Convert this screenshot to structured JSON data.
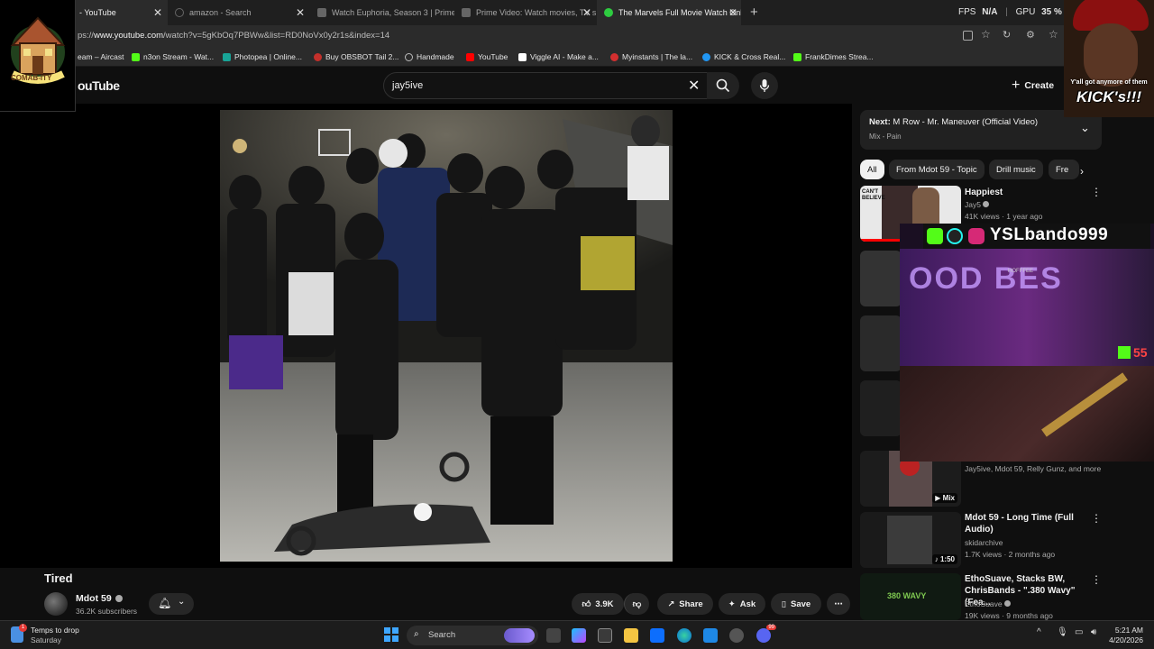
{
  "tabs": [
    {
      "title": "- YouTube",
      "active": true
    },
    {
      "title": "amazon - Search",
      "active": false
    },
    {
      "title": "Watch Euphoria, Season 3 | Prime",
      "active": false
    },
    {
      "title": "Prime Video: Watch movies, TV sh",
      "active": false
    },
    {
      "title": "The Marvels Full Movie Watch Onl",
      "active": false
    }
  ],
  "browser": {
    "fps_label": "FPS",
    "fps_value": "N/A",
    "gpu_label": "GPU",
    "gpu_value": "35 %",
    "url_prefix": "ps://",
    "url_host": "www.youtube.com",
    "url_rest": "/watch?v=5gKbOq7PBWw&list=RD0NoVx0y2r1s&index=14"
  },
  "bookmarks": [
    {
      "label": "eam – Aircast",
      "color": "#1f1f1f"
    },
    {
      "label": "n3on Stream - Wat...",
      "color": "#53fc18"
    },
    {
      "label": "Photopea | Online...",
      "color": "#18a497"
    },
    {
      "label": "Buy OBSBOT Tail 2...",
      "color": "#c4302b"
    },
    {
      "label": "Handmade",
      "color": "#888888"
    },
    {
      "label": "YouTube",
      "color": "#ff0000"
    },
    {
      "label": "Viggle AI - Make a...",
      "color": "#ffffff"
    },
    {
      "label": "Myinstants | The la...",
      "color": "#d32f2f"
    },
    {
      "label": "KICK & Cross Real...",
      "color": "#2196f3"
    },
    {
      "label": "FrankDimes Strea...",
      "color": "#53fc18"
    }
  ],
  "youtube": {
    "logo_text": "ouTube",
    "search_value": "jay5ive",
    "create_label": "Create"
  },
  "video": {
    "title": "Tired",
    "channel": "Mdot 59",
    "subscribers": "36.2K subscribers",
    "likes": "3.9K",
    "share_label": "Share",
    "ask_label": "Ask",
    "save_label": "Save"
  },
  "playlist": {
    "next_label": "Next:",
    "next_title": "M Row - Mr. Maneuver (Official Video)",
    "next_sub": "Mix - Pain"
  },
  "chips": [
    "All",
    "From Mdot 59 - Topic",
    "Drill music",
    "Fre"
  ],
  "recommendations": [
    {
      "title": "Happiest",
      "channel": "Jay5",
      "meta": "41K views · 1 year ago",
      "thumb_text": "CAN'T BELIEVE"
    },
    {
      "title": "",
      "channel": "Jay5ive, Mdot 59, Relly Gunz, and more",
      "meta": "",
      "badge": "Mix"
    },
    {
      "title": "Mdot 59 - Long Time (Full Audio)",
      "channel": "skidarchive",
      "meta": "1.7K views · 2 months ago",
      "badge": "1:50"
    },
    {
      "title": "EthoSuave, Stacks BW, ChrisBands - \".380 Wavy\" (Fea...",
      "channel": "EthoSuave",
      "meta": "19K views · 9 months ago",
      "thumb_text": "380 WAVY"
    }
  ],
  "overlays": {
    "logo_text": "COMAB-ITY",
    "cam_caption_top": "Y'all got anymore of them",
    "cam_caption_big": "KICK's!!!",
    "stream_handle": "YSLbando999",
    "stream_neon": "OOD BES",
    "stream_banner": "HOFFFEE",
    "kick_count": "55"
  },
  "taskbar": {
    "weather_line1": "Temps to drop",
    "weather_line2": "Saturday",
    "weather_badge": "1",
    "search_placeholder": "Search",
    "time": "5:21 AM",
    "date": "4/20/2026",
    "discord_badge": "99"
  }
}
